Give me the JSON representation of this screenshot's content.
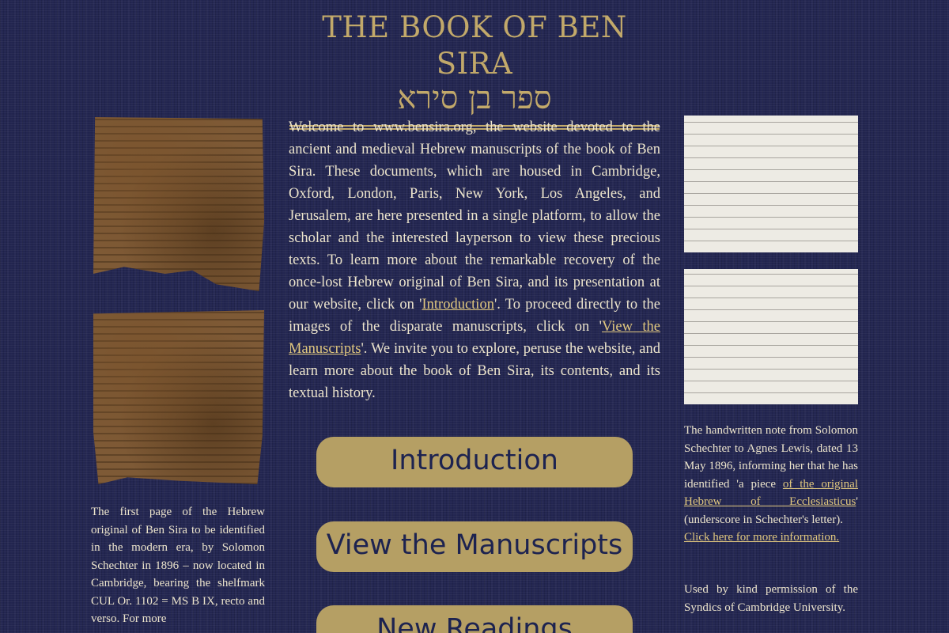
{
  "header": {
    "title": "THE BOOK OF BEN SIRA",
    "title_hebrew": "ספר בן סירא"
  },
  "welcome": {
    "text_1": "Welcome to www.bensira.org, the website devoted to the ancient and medieval Hebrew manuscripts of the book of Ben Sira. These documents, which are housed in Cambridge, Oxford, London, Paris, New York, Los Angeles, and Jerusalem, are here presented in a single platform, to allow the scholar and the interested layperson to view these precious texts. To learn more about the remarkable recovery of the once-lost Hebrew original of Ben Sira, and its presentation at our website, click on '",
    "link_introduction": "Introduction",
    "text_2": "'. To proceed directly to the images of the disparate manuscripts, click on '",
    "link_view_manuscripts": "View the Manuscripts",
    "text_3": "'. We invite you to explore, peruse the website, and learn more about the book of Ben Sira, its contents, and its textual history."
  },
  "buttons": {
    "introduction": "Introduction",
    "view_manuscripts": "View the Manuscripts",
    "new_readings": "New Readings"
  },
  "left_column": {
    "caption": "The first page of the Hebrew original of Ben Sira to be identified in the modern era, by Solomon Schechter in 1896 – now located in Cambridge, bearing the shelfmark CUL Or. 1102 = MS B IX, recto and verso. For more"
  },
  "right_column": {
    "caption_1": "The handwritten note from Solomon Schechter to Agnes Lewis, dated 13 May 1896, informing her that he has identified 'a piece ",
    "caption_link": "of the original Hebrew of Ecclesiasticus",
    "caption_2": "' (underscore in Schechter's letter).",
    "more_info_link": "Click here for more information.",
    "permission": "Used by kind permission of the Syndics of Cambridge University."
  },
  "colors": {
    "background": "#232651",
    "gold_accent": "#c2a96a",
    "button_fill": "#b59f64",
    "button_text": "#1d2350",
    "link": "#e0c77e"
  }
}
